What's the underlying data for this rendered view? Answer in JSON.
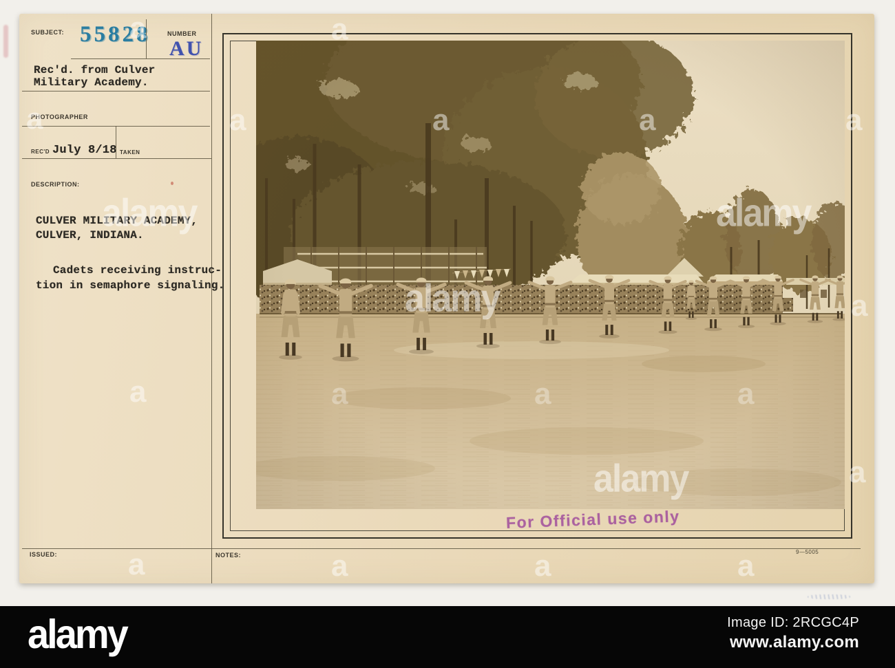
{
  "card": {
    "fields": {
      "subject_label": "SUBJECT:",
      "subject_value": "55828",
      "number_label": "NUMBER",
      "number_value": "AU",
      "received_line1": "Rec'd. from Culver",
      "received_line2": "Military Academy.",
      "photographer_label": "PHOTOGRAPHER",
      "recd_label": "REC'D",
      "recd_date": "July 8/18",
      "taken_label": "TAKEN",
      "description_label": "DESCRIPTION:",
      "description_line1": "CULVER MILITARY ACADEMY,",
      "description_line2": "CULVER, INDIANA.",
      "description_line3": "Cadets receiving instruc-",
      "description_line4": "tion in semaphore signaling.",
      "issued_label": "ISSUED:",
      "notes_label": "NOTES:",
      "print_code": "9—5005"
    },
    "stamp_text": "For Official use only"
  },
  "watermark": {
    "logo_text": "alamy",
    "letter": "a"
  },
  "footer": {
    "logo": "alamy",
    "image_id": "Image ID: 2RCGC4P",
    "site": "www.alamy.com"
  }
}
